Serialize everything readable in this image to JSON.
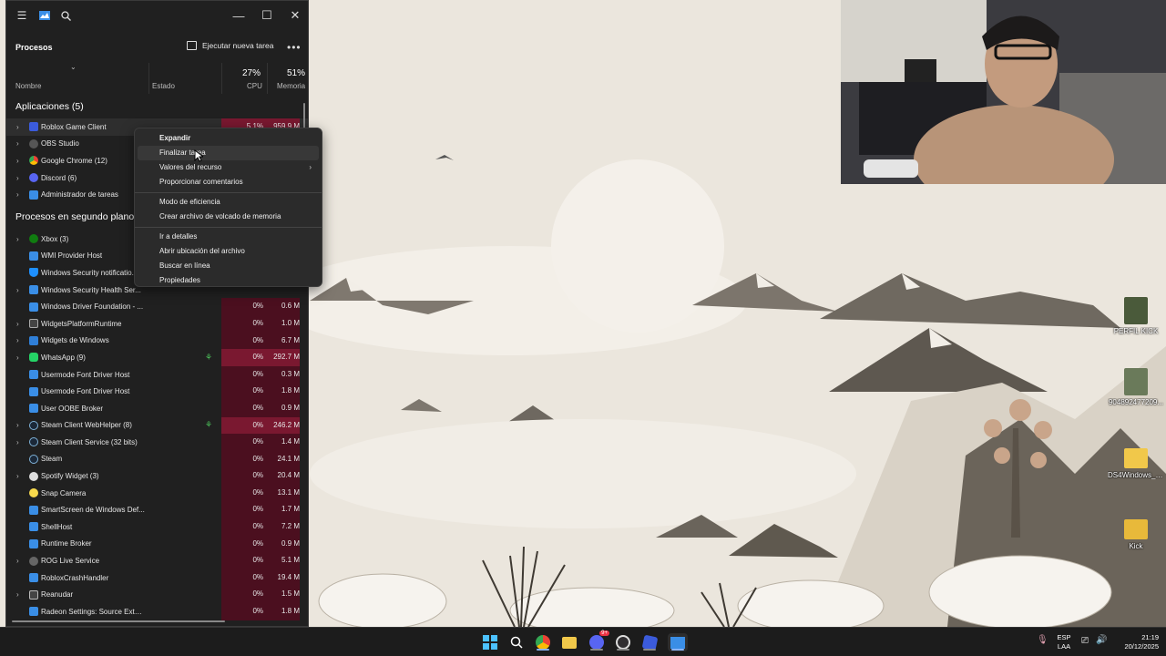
{
  "taskmgr": {
    "header_title": "Procesos",
    "new_task_label": "Ejecutar nueva tarea",
    "more_label": "•••",
    "columns": {
      "name": "Nombre",
      "status": "Estado",
      "cpu_pct": "27%",
      "cpu_label": "CPU",
      "mem_pct": "51%",
      "mem_label": "Memoria"
    },
    "groups": {
      "apps": "Aplicaciones (5)",
      "background": "Procesos en segundo plano"
    },
    "apps": [
      {
        "name": "Roblox Game Client",
        "cpu": "5.1%",
        "mem": "959.9 M"
      },
      {
        "name": "OBS Studio"
      },
      {
        "name": "Google Chrome (12)"
      },
      {
        "name": "Discord (6)"
      },
      {
        "name": "Administrador de tareas"
      }
    ],
    "background": [
      {
        "name": "Xbox (3)"
      },
      {
        "name": "WMI Provider Host"
      },
      {
        "name": "Windows Security notificatio..."
      },
      {
        "name": "Windows Security Health Ser..."
      },
      {
        "name": "Windows Driver Foundation - ...",
        "cpu": "0%",
        "mem": "0.6 M"
      },
      {
        "name": "WidgetsPlatformRuntime",
        "cpu": "0%",
        "mem": "1.0 M"
      },
      {
        "name": "Widgets de Windows",
        "cpu": "0%",
        "mem": "6.7 M"
      },
      {
        "name": "WhatsApp (9)",
        "cpu": "0%",
        "mem": "292.7 M"
      },
      {
        "name": "Usermode Font Driver Host",
        "cpu": "0%",
        "mem": "0.3 M"
      },
      {
        "name": "Usermode Font Driver Host",
        "cpu": "0%",
        "mem": "1.8 M"
      },
      {
        "name": "User OOBE Broker",
        "cpu": "0%",
        "mem": "0.9 M"
      },
      {
        "name": "Steam Client WebHelper (8)",
        "cpu": "0%",
        "mem": "246.2 M"
      },
      {
        "name": "Steam Client Service (32 bits)",
        "cpu": "0%",
        "mem": "1.4 M"
      },
      {
        "name": "Steam",
        "cpu": "0%",
        "mem": "24.1 M"
      },
      {
        "name": "Spotify Widget (3)",
        "cpu": "0%",
        "mem": "20.4 M"
      },
      {
        "name": "Snap Camera",
        "cpu": "0%",
        "mem": "13.1 M"
      },
      {
        "name": "SmartScreen de Windows Def...",
        "cpu": "0%",
        "mem": "1.7 M"
      },
      {
        "name": "ShellHost",
        "cpu": "0%",
        "mem": "7.2 M"
      },
      {
        "name": "Runtime Broker",
        "cpu": "0%",
        "mem": "0.9 M"
      },
      {
        "name": "ROG Live Service",
        "cpu": "0%",
        "mem": "5.1 M"
      },
      {
        "name": "RobloxCrashHandler",
        "cpu": "0%",
        "mem": "19.4 M"
      },
      {
        "name": "Reanudar",
        "cpu": "0%",
        "mem": "1.5 M"
      },
      {
        "name": "Radeon Settings: Source Exten...",
        "cpu": "0%",
        "mem": "1.8 M"
      }
    ]
  },
  "context_menu": {
    "expand": "Expandir",
    "end_task": "Finalizar tarea",
    "resource_values": "Valores del recurso",
    "feedback": "Proporcionar comentarios",
    "efficiency": "Modo de eficiencia",
    "dump": "Crear archivo de volcado de memoria",
    "details": "Ir a detalles",
    "open_location": "Abrir ubicación del archivo",
    "search_online": "Buscar en línea",
    "properties": "Propiedades"
  },
  "desktop_icons": [
    {
      "label": "PERFIL KICK"
    },
    {
      "label": "904892477209..."
    },
    {
      "label": "DS4Windows_3..."
    },
    {
      "label": "Kick"
    }
  ],
  "tray": {
    "lang_top": "ESP",
    "lang_bottom": "LAA",
    "time": "21:19",
    "date": "20/12/2025",
    "discord_badge": "9+"
  },
  "colors": {
    "taskmgr_bg": "#202020",
    "cpu_heat": "#4b0f1f",
    "cpu_hot": "#7a1830",
    "menu_bg": "#2b2b2b",
    "taskbar_bg": "#1c1c1c",
    "accent": "#8ab4f8"
  }
}
